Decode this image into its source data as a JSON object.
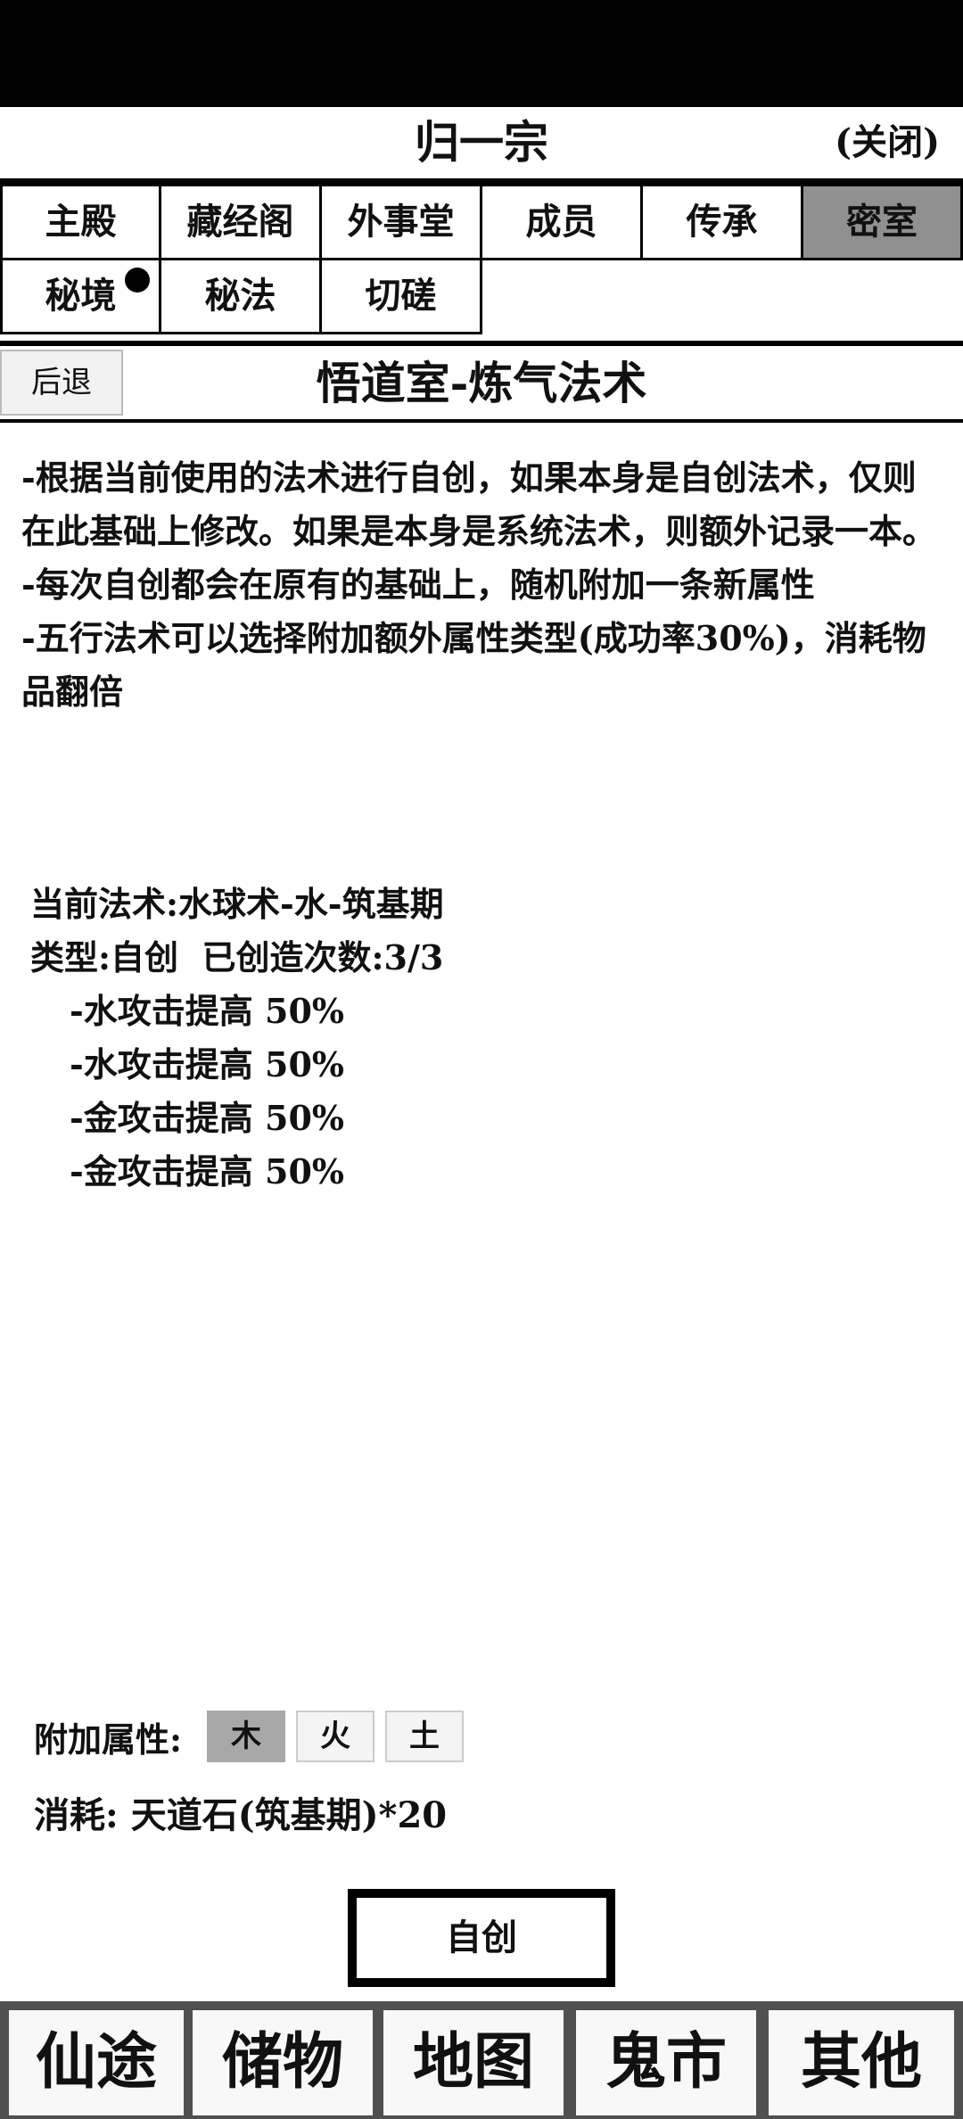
{
  "header": {
    "title": "归一宗",
    "close_label": "(关闭)"
  },
  "tabs": [
    {
      "label": "主殿",
      "active": false
    },
    {
      "label": "藏经阁",
      "active": false
    },
    {
      "label": "外事堂",
      "active": false
    },
    {
      "label": "成员",
      "active": false
    },
    {
      "label": "传承",
      "active": false
    },
    {
      "label": "密室",
      "active": true
    },
    {
      "label": "秘境",
      "active": false,
      "badge": true
    },
    {
      "label": "秘法",
      "active": false
    },
    {
      "label": "切磋",
      "active": false
    }
  ],
  "subheader": {
    "back_label": "后退",
    "title": "悟道室-炼气法术"
  },
  "description": [
    "-根据当前使用的法术进行自创，如果本身是自创法术，仅则在此基础上修改。如果是本身是系统法术，则额外记录一本。",
    "-每次自创都会在原有的基础上，随机附加一条新属性",
    "-五行法术可以选择附加额外属性类型(成功率30%)，消耗物品翻倍"
  ],
  "spell": {
    "current": "当前法术:水球术-水-筑基期",
    "type_line": "类型:自创  已创造次数:3/3",
    "attributes": [
      "-水攻击提高 50%",
      "-水攻击提高 50%",
      "-金攻击提高 50%",
      "-金攻击提高 50%"
    ]
  },
  "extra_attr": {
    "label": "附加属性:",
    "options": [
      {
        "label": "木",
        "selected": true
      },
      {
        "label": "火",
        "selected": false
      },
      {
        "label": "土",
        "selected": false
      }
    ]
  },
  "cost": "消耗: 天道石(筑基期)*20",
  "create_button": "自创",
  "bottom_nav": [
    "仙途",
    "储物",
    "地图",
    "鬼市",
    "其他"
  ],
  "colors": {
    "active_tab": "#909090",
    "selected_chip": "#a8a8a8",
    "nav_bg": "#505050"
  }
}
